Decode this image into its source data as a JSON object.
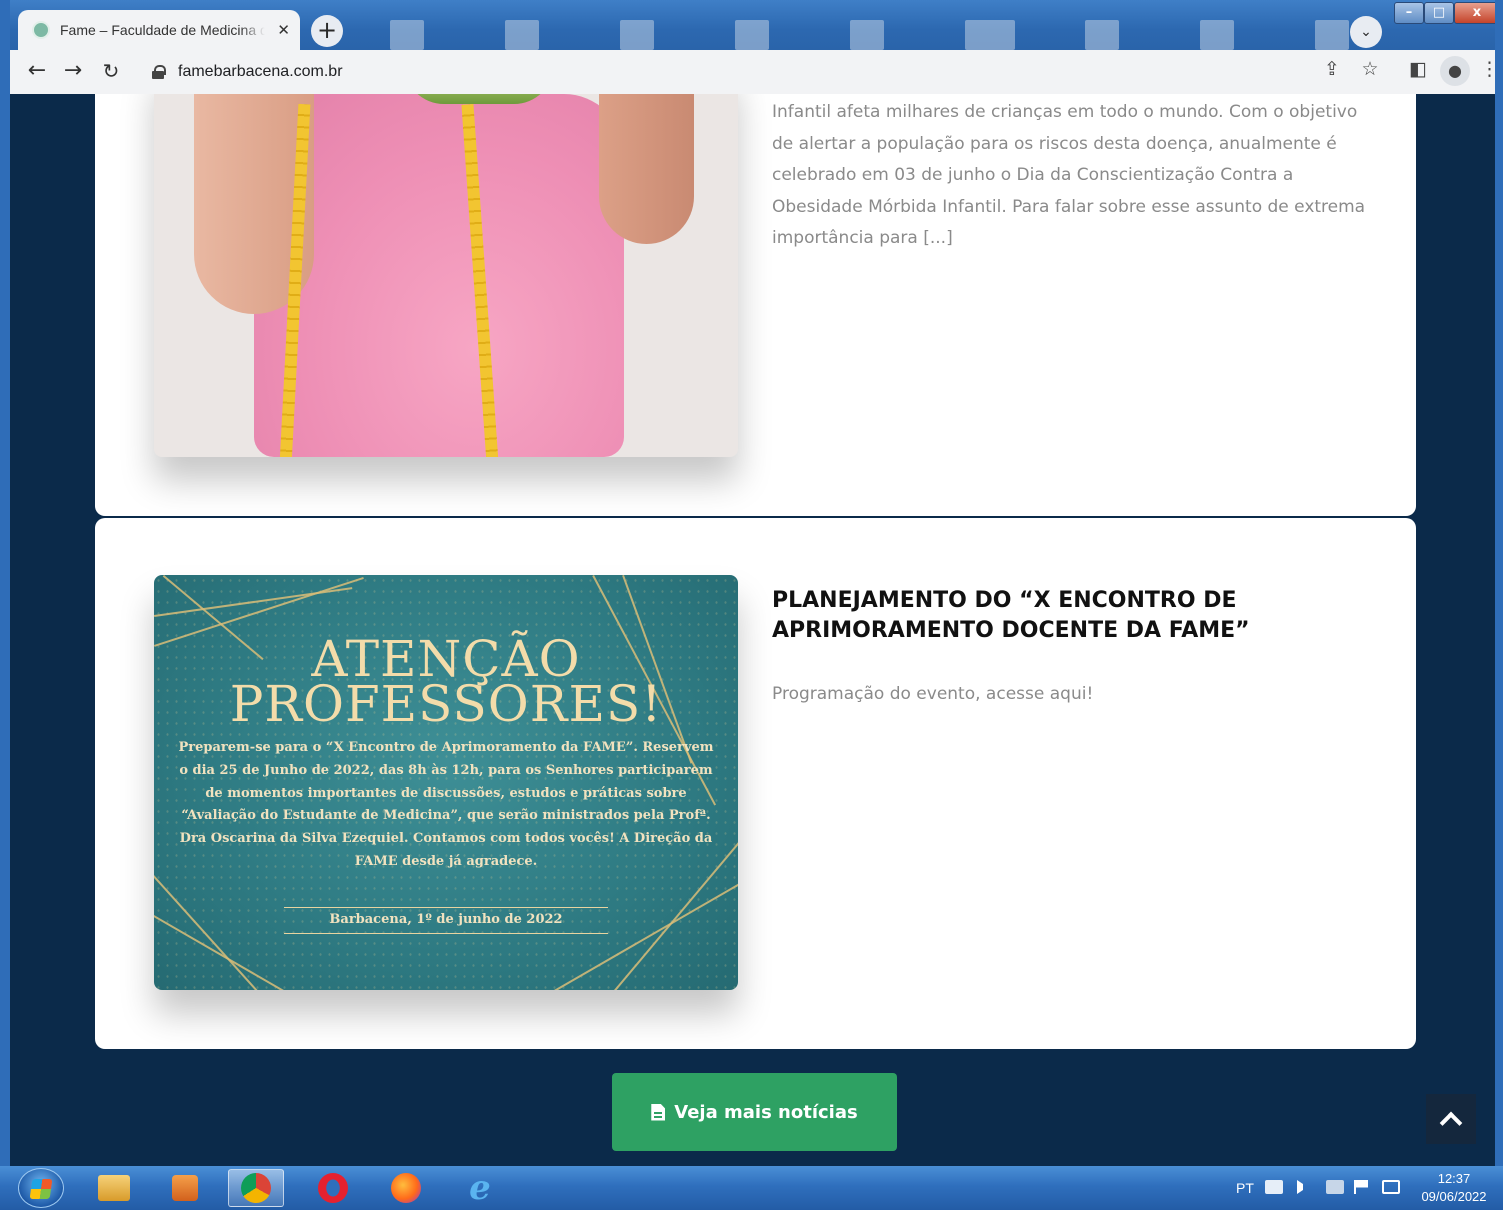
{
  "browser": {
    "tab_title": "Fame – Faculdade de Medicina de Barbacena",
    "tab_close": "✕",
    "new_tab": "+",
    "url": "famebarbacena.com.br",
    "window_controls": {
      "minimize": "–",
      "maximize": "□",
      "close": "x"
    }
  },
  "posts": [
    {
      "excerpt": "Infantil afeta milhares de crianças em todo o mundo. Com o objetivo de alertar a população para os riscos desta doença, anualmente é celebrado em 03 de junho o Dia da Conscientização Contra a Obesidade Mórbida Infantil. Para falar sobre esse assunto de extrema importância para [...]"
    },
    {
      "title": "PLANEJAMENTO DO “X ENCONTRO DE APRIMORAMENTO DOCENTE DA FAME”",
      "excerpt": "Programação do evento, acesse aqui!",
      "image": {
        "headline_1": "ATENÇÃO",
        "headline_2": "PROFESSORES!",
        "body": "Preparem-se para o “X Encontro de Aprimoramento da FAME”. Reservem o dia 25 de Junho de 2022, das 8h às 12h, para os Senhores participarem de momentos importantes de discussões, estudos e práticas sobre “Avaliação do Estudante de Medicina”, que serão ministrados pela Profª. Dra Oscarina da Silva Ezequiel. Contamos com todos vocês! A Direção da FAME desde já agradece.",
        "date": "Barbacena, 1º de junho de 2022"
      }
    }
  ],
  "more_news_button": "Veja mais notícias",
  "taskbar": {
    "language": "PT",
    "time": "12:37",
    "date": "09/06/2022"
  },
  "colors": {
    "page_bg": "#0b2a4a",
    "button_green": "#2ea163",
    "promo_teal": "#2e7a82",
    "promo_gold": "#f3dcaa"
  },
  "icons": [
    "back-icon",
    "forward-icon",
    "reload-icon",
    "lock-icon",
    "share-icon",
    "star-icon",
    "sidepanel-icon",
    "profile-icon",
    "menu-icon",
    "document-icon",
    "chevron-up-icon"
  ]
}
